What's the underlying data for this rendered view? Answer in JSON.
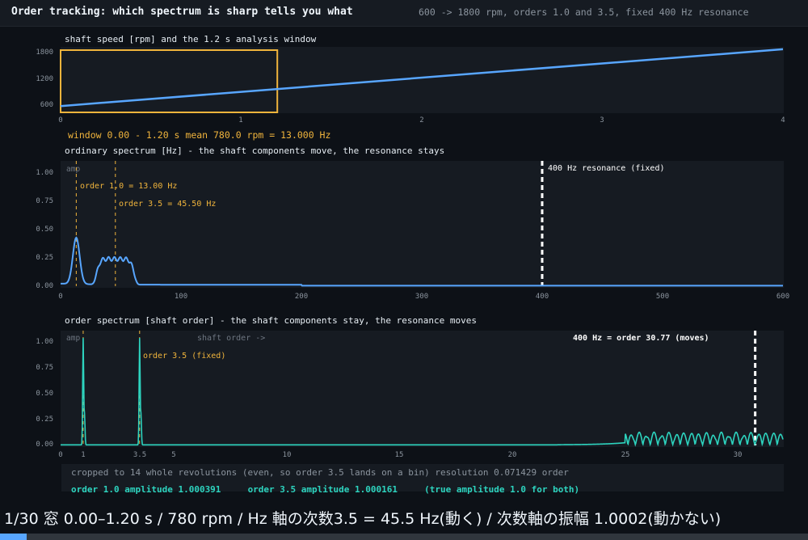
{
  "header": {
    "title": "Order tracking: which spectrum is sharp tells you what",
    "subtitle": "600 -> 1800 rpm, orders 1.0 and 3.5, fixed 400 Hz resonance"
  },
  "colors": {
    "background": "#0d1117",
    "panel": "#161b22",
    "speed_line": "#58a6ff",
    "window_box": "#f0b43c",
    "order_line": "#2dd4bf",
    "marker": "#ffffff",
    "progress": "#58a6ff"
  },
  "speed_panel": {
    "title": "shaft speed [rpm] and the 1.2 s analysis window",
    "yticks": [
      "1800",
      "1200",
      "600"
    ],
    "xticks": [
      "0",
      "1",
      "2",
      "3",
      "4"
    ]
  },
  "window_info": "window 0.00 - 1.20 s   mean   780.0 rpm = 13.000 Hz",
  "hz_panel": {
    "title": "ordinary spectrum [Hz] - the shaft components move, the resonance stays",
    "ylabel": "amp",
    "yticks": [
      "1.00",
      "0.75",
      "0.50",
      "0.25",
      "0.00"
    ],
    "xticks": [
      "0",
      "100",
      "200",
      "300",
      "400",
      "500",
      "600"
    ],
    "ann_order1": "order 1.0 = 13.00 Hz",
    "ann_order35": "order 3.5 = 45.50 Hz",
    "ann_resonance": "400 Hz resonance (fixed)"
  },
  "order_panel": {
    "title": "order spectrum [shaft order] - the shaft components stay, the resonance moves",
    "ylabel": "amp",
    "arrow_label": "shaft order ->",
    "yticks": [
      "1.00",
      "0.75",
      "0.50",
      "0.25",
      "0.00"
    ],
    "xticks": [
      "0",
      "1",
      "3.5",
      "5",
      "10",
      "15",
      "20",
      "25",
      "30"
    ],
    "ann_order35": "order 3.5 (fixed)",
    "ann_resonance": "400 Hz = order 30.77 (moves)"
  },
  "info": {
    "line1": "cropped to 14 whole revolutions (even, so order 3.5 lands on a bin)   resolution 0.071429 order",
    "amp1": "order 1.0 amplitude 1.000391",
    "amp35": "order 3.5 amplitude 1.000161",
    "note": "(true amplitude 1.0 for both)"
  },
  "caption": "1/30  窓 0.00–1.20 s  /  780 rpm  /  Hz 軸の次数3.5 = 45.5 Hz(動く)  /  次数軸の振幅 1.0002(動かない)",
  "progress": {
    "current": 1,
    "total": 30,
    "fraction": 0.0333
  },
  "chart_data": [
    {
      "type": "line",
      "title": "shaft speed [rpm] and the 1.2 s analysis window",
      "xlim": [
        0,
        4
      ],
      "ylim": [
        450,
        1850
      ],
      "series": [
        {
          "x": [
            0,
            4
          ],
          "values": [
            600,
            1800
          ]
        }
      ],
      "window_s": [
        0.0,
        1.2
      ],
      "window_mean_rpm": 780.0
    },
    {
      "type": "line",
      "title": "ordinary spectrum [Hz] - the shaft components move, the resonance stays",
      "xlim": [
        0,
        600
      ],
      "ylim": [
        0,
        1.08
      ],
      "peaks": [
        {
          "label": "order 1.0",
          "x": 13.0,
          "amp": 0.4,
          "width": 4
        },
        {
          "label": "order 3.5",
          "x": 45.5,
          "amp": 0.22,
          "width": 16
        },
        {
          "label": "resonance",
          "x": 400,
          "amp": 1.0,
          "width": 0.5
        }
      ],
      "markers_x": [
        13.0,
        45.5,
        400
      ]
    },
    {
      "type": "line",
      "title": "order spectrum [shaft order] - the shaft components stay, the resonance moves",
      "xlim": [
        0,
        32
      ],
      "ylim": [
        0,
        1.08
      ],
      "peaks": [
        {
          "label": "order 1.0",
          "x": 1.0,
          "amp": 1.0
        },
        {
          "label": "order 3.5",
          "x": 3.5,
          "amp": 1.0
        }
      ],
      "resonance_band": [
        25,
        32
      ],
      "resonance_band_amp": 0.12,
      "markers_x": [
        1.0,
        3.5,
        30.77
      ]
    }
  ]
}
